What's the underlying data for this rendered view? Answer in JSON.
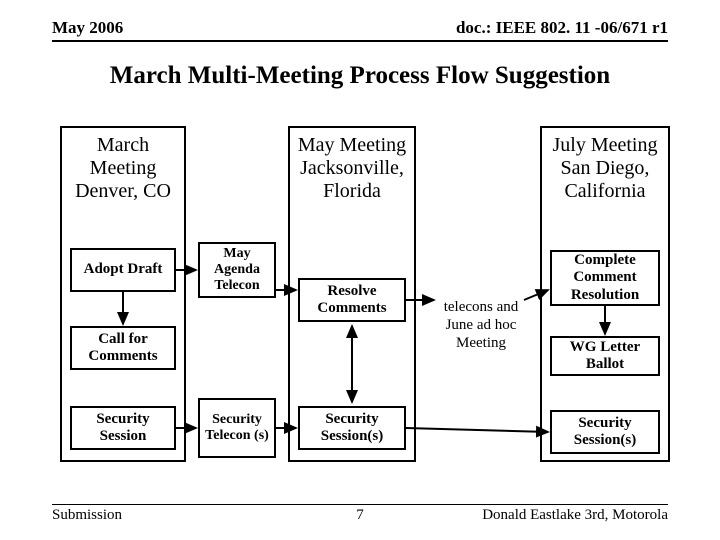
{
  "header": {
    "left": "May 2006",
    "right": "doc.: IEEE 802. 11 -06/671 r1"
  },
  "title": "March Multi-Meeting Process Flow Suggestion",
  "columns": {
    "march": {
      "title": "March Meeting Denver, CO"
    },
    "may": {
      "title": "May Meeting Jacksonville, Florida"
    },
    "july": {
      "title": "July Meeting San Diego, California"
    }
  },
  "boxes": {
    "adopt_draft": "Adopt Draft",
    "call_comments": "Call for Comments",
    "security_session": "Security Session",
    "may_agenda": "May Agenda Telecon",
    "sec_telecon": "Security Telecon (s)",
    "resolve_comments": "Resolve Comments",
    "sec_sessions_may": "Security Session(s)",
    "complete_res": "Complete Comment Resolution",
    "wg_ballot": "WG Letter Ballot",
    "sec_sessions_july": "Security Session(s)"
  },
  "free_text": {
    "telecons": "telecons and June ad hoc Meeting"
  },
  "footer": {
    "left": "Submission",
    "center": "7",
    "right": "Donald Eastlake 3rd, Motorola"
  }
}
